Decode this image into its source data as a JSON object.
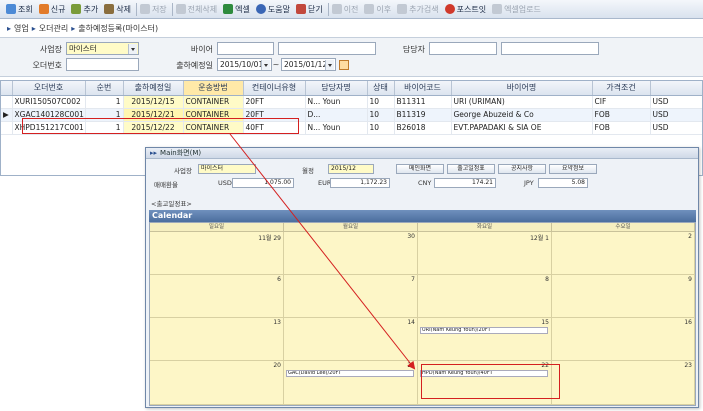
{
  "toolbar": {
    "items": [
      {
        "label": "조회",
        "icon": "search-icon",
        "enabled": true
      },
      {
        "label": "신규",
        "icon": "new-icon",
        "enabled": true
      },
      {
        "label": "추가",
        "icon": "add-icon",
        "enabled": true
      },
      {
        "label": "삭제",
        "icon": "delete-icon",
        "enabled": true
      },
      {
        "label": "저장",
        "icon": "save-icon",
        "enabled": false
      },
      {
        "label": "전체삭제",
        "icon": "delete-all-icon",
        "enabled": false
      },
      {
        "label": "엑셀",
        "icon": "excel-icon",
        "enabled": true
      },
      {
        "label": "도움말",
        "icon": "help-icon",
        "enabled": true
      },
      {
        "label": "닫기",
        "icon": "close-icon",
        "enabled": true
      },
      {
        "label": "이전",
        "icon": "prev-icon",
        "enabled": false
      },
      {
        "label": "이후",
        "icon": "next-icon",
        "enabled": false
      },
      {
        "label": "추가검색",
        "icon": "extra-search-icon",
        "enabled": false
      },
      {
        "label": "포스트잇",
        "icon": "postit-icon",
        "enabled": true
      },
      {
        "label": "엑셀업로드",
        "icon": "excel-upload-icon",
        "enabled": false
      }
    ]
  },
  "breadcrumb": {
    "items": [
      "영업",
      "오더관리",
      "출하예정등록(마이스터)"
    ]
  },
  "search": {
    "company_label": "사업장",
    "company_value": "마이스터",
    "buyer_label": "바이어",
    "manager_label": "담당자",
    "order_no_label": "오더번호",
    "ship_date_label": "출하예정일",
    "date_from": "2015/10/01",
    "date_sep": "~",
    "date_to": "2015/01/12"
  },
  "grid": {
    "columns": [
      "오더번호",
      "순번",
      "출하예정일",
      "운송방법",
      "컨테이너유형",
      "담당자명",
      "상태",
      "바이어코드",
      "바이어명",
      "가격조건",
      ""
    ],
    "rows": [
      {
        "order_no": "XURI150507C002",
        "seq": "1",
        "ship_date": "2015/12/15",
        "transport": "CONTAINER",
        "container": "20FT",
        "manager": "N... Youn",
        "status": "10",
        "buyer_code": "B11311",
        "buyer_name": "URI (URIMAN)",
        "price_term": "CIF",
        "currency": "USD"
      },
      {
        "order_no": "XGAC140128C001",
        "seq": "1",
        "ship_date": "2015/12/21",
        "transport": "CONTAINER",
        "container": "20FT",
        "manager": "D...",
        "status": "10",
        "buyer_code": "B11319",
        "buyer_name": "George Abuzeid & Co",
        "price_term": "FOB",
        "currency": "USD"
      },
      {
        "order_no": "XHPD151217C001",
        "seq": "1",
        "ship_date": "2015/12/22",
        "transport": "CONTAINER",
        "container": "40FT",
        "manager": "N... Youn",
        "status": "10",
        "buyer_code": "B26018",
        "buyer_name": "EVT.PAPADAKI & SIA OE",
        "price_term": "FOB",
        "currency": "USD"
      }
    ]
  },
  "popup": {
    "title": "Main화면(M)",
    "company_label": "사업장",
    "company_value": "마이스터",
    "month_label": "월정",
    "month_value": "2015/12",
    "buttons": [
      "메인화면",
      "출고일정표",
      "공지사항",
      "요약정보"
    ],
    "fx_label": "매매환율",
    "fx": [
      {
        "ccy": "USD",
        "rate": "1,075.00"
      },
      {
        "ccy": "EUR",
        "rate": "1,172.23"
      },
      {
        "ccy": "CNY",
        "rate": "174.21"
      },
      {
        "ccy": "JPY",
        "rate": "5.08"
      }
    ],
    "section_label": "<출고일정표>",
    "calendar_title": "Calendar",
    "weekdays": [
      "일요일",
      "월요일",
      "화요일",
      "수요일"
    ],
    "weeks": [
      {
        "days": [
          "11월 29",
          "30",
          "12월 1",
          "2"
        ]
      },
      {
        "days": [
          "6",
          "7",
          "8",
          "9"
        ]
      },
      {
        "days": [
          "13",
          "14",
          "15",
          "16"
        ]
      },
      {
        "days": [
          "20",
          "21",
          "22",
          "23"
        ]
      }
    ],
    "events": [
      {
        "text": "URI(Nam Keung Youn)/20FT"
      },
      {
        "text": "GAC(David Lee)/20FT"
      },
      {
        "text": "HPD(Nam Keung Youn)/40FT"
      }
    ]
  },
  "colors": {
    "accent": "#4b6e9e",
    "highlight": "#d42020",
    "cell_yellow": "#fffbc7",
    "calendar_bg": "#fdf6c7"
  }
}
